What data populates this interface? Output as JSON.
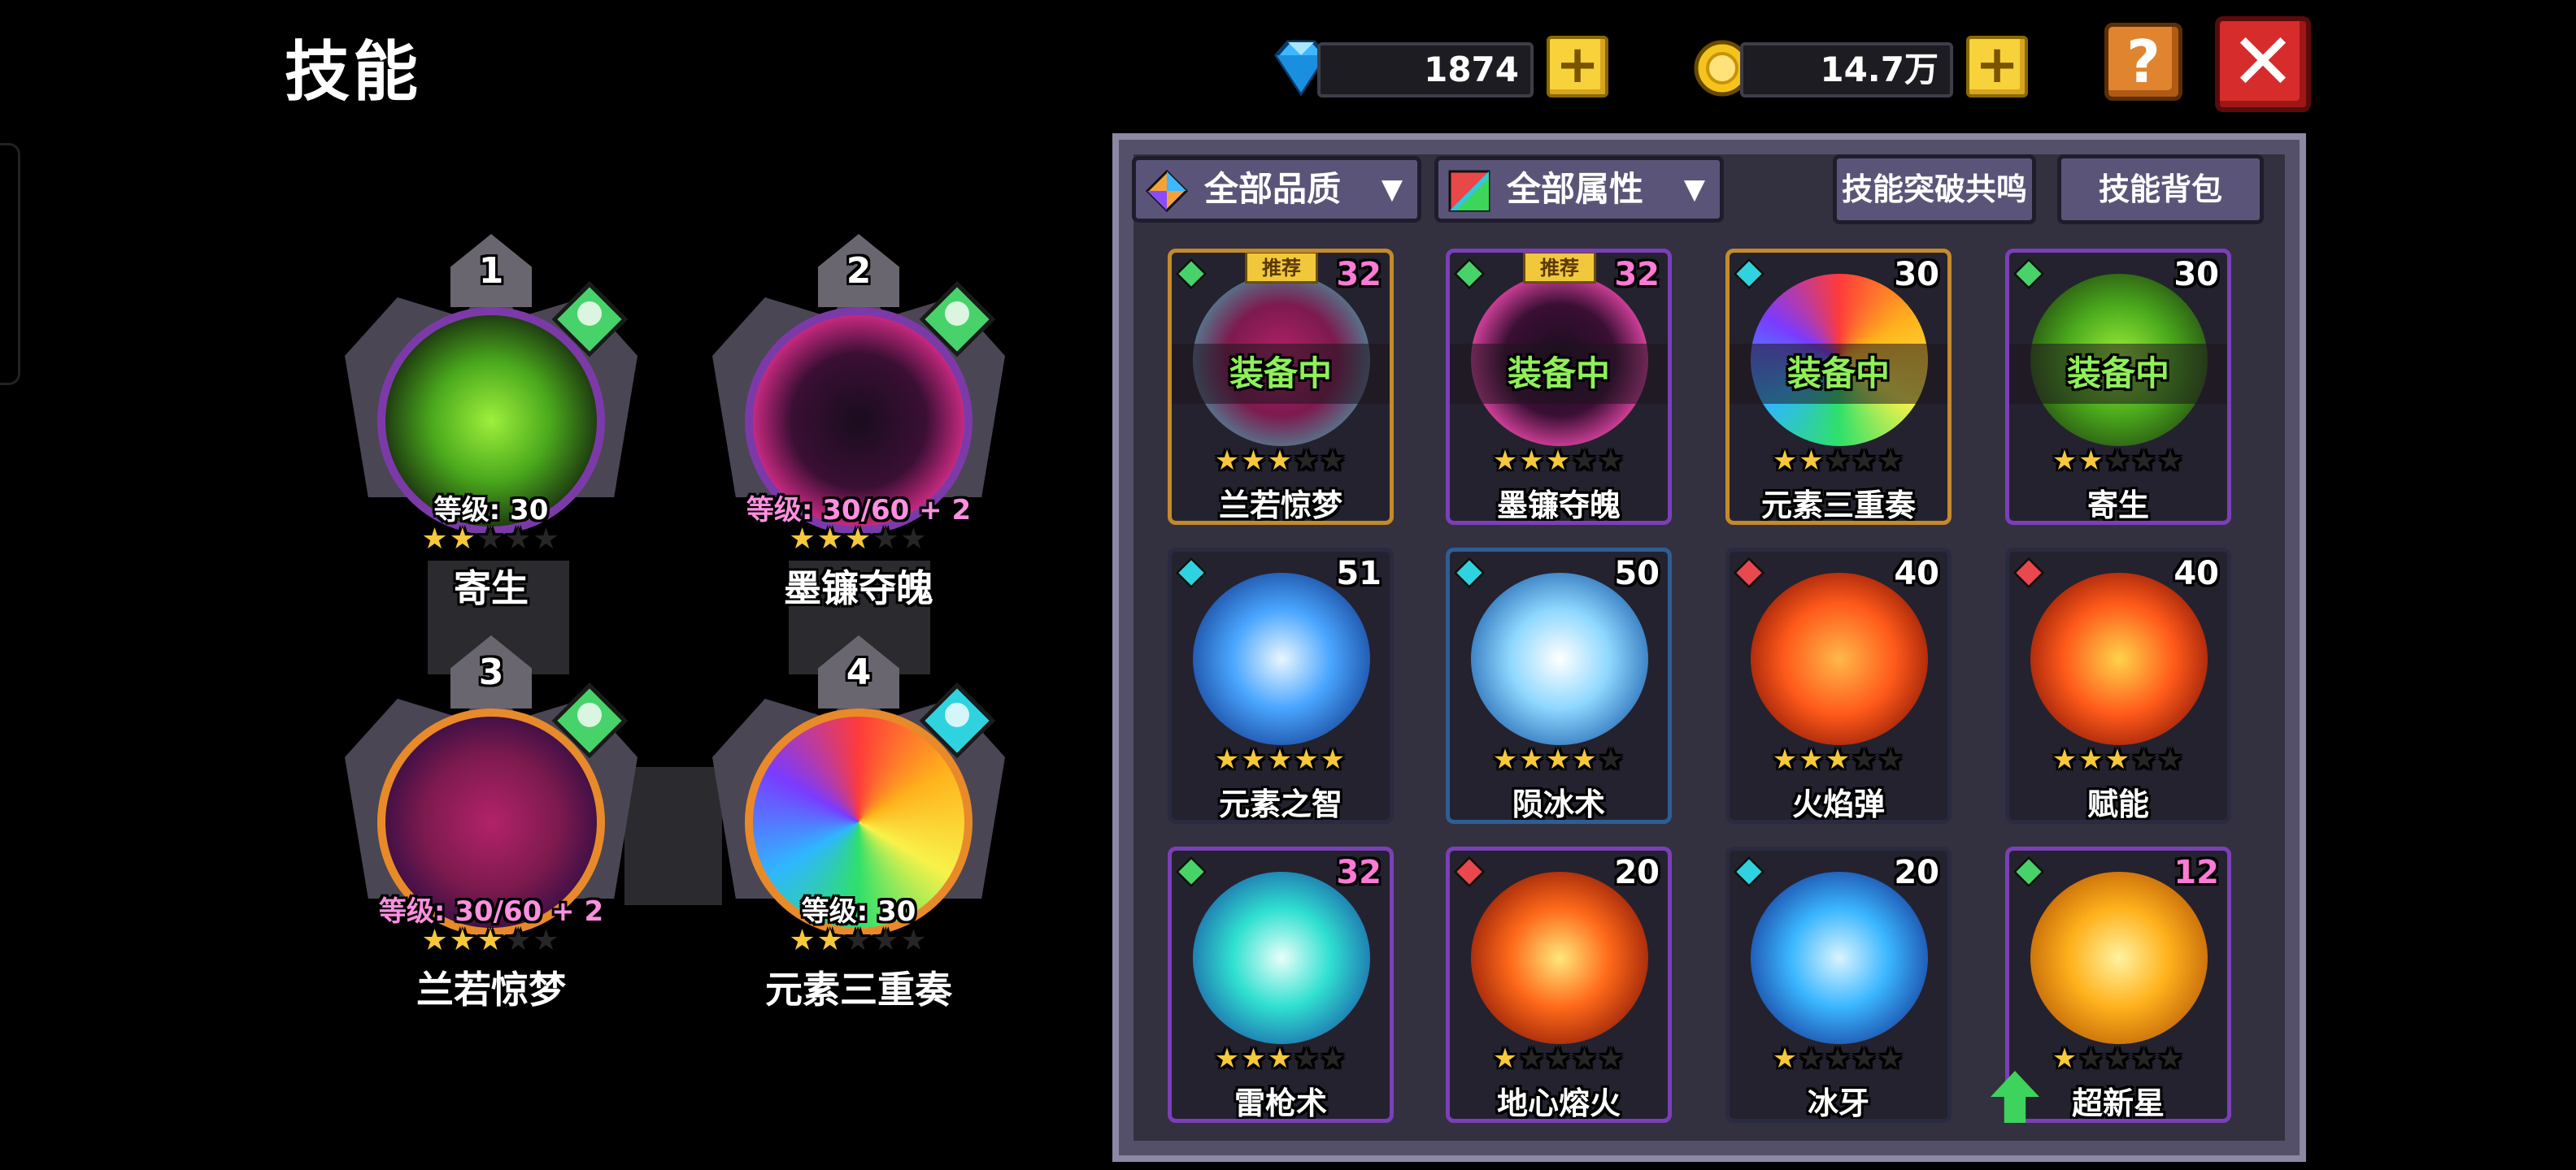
{
  "header": {
    "title": "技能"
  },
  "currencies": {
    "diamond": {
      "value": "1874",
      "icon": "diamond-icon"
    },
    "gold": {
      "value": "14.7万",
      "icon": "gold-coin-icon"
    }
  },
  "buttons": {
    "help": "?",
    "close": "✕",
    "add": "+"
  },
  "equipped_slots": [
    {
      "slot": "1",
      "level": "等级: 30",
      "stars": 2,
      "name": "寄生",
      "gem": "green"
    },
    {
      "slot": "2",
      "level": "等级: 30/60 + 2",
      "stars": 3,
      "name": "墨镰夺魄",
      "gem": "green"
    },
    {
      "slot": "3",
      "level": "等级: 30/60 + 2",
      "stars": 3,
      "name": "兰若惊梦",
      "gem": "green"
    },
    {
      "slot": "4",
      "level": "等级: 30",
      "stars": 2,
      "name": "元素三重奏",
      "gem": "cyan"
    }
  ],
  "filters": {
    "quality": "全部品质",
    "attribute": "全部属性",
    "breakthrough": "技能突破共鸣",
    "bag": "技能背包"
  },
  "labels": {
    "equipped": "装备中",
    "recommended": "推荐"
  },
  "skills": [
    {
      "name": "兰若惊梦",
      "count": "32",
      "stars": 3,
      "equipped": true,
      "recommended": true,
      "gem": "green"
    },
    {
      "name": "墨镰夺魄",
      "count": "32",
      "stars": 3,
      "equipped": true,
      "recommended": true,
      "gem": "green"
    },
    {
      "name": "元素三重奏",
      "count": "30",
      "stars": 2,
      "equipped": true,
      "recommended": false,
      "gem": "cyan"
    },
    {
      "name": "寄生",
      "count": "30",
      "stars": 2,
      "equipped": true,
      "recommended": false,
      "gem": "green"
    },
    {
      "name": "元素之智",
      "count": "51",
      "stars": 5,
      "equipped": false,
      "recommended": false,
      "gem": "cyan"
    },
    {
      "name": "陨冰术",
      "count": "50",
      "stars": 4,
      "equipped": false,
      "recommended": false,
      "gem": "cyan"
    },
    {
      "name": "火焰弹",
      "count": "40",
      "stars": 3,
      "equipped": false,
      "recommended": false,
      "gem": "red"
    },
    {
      "name": "赋能",
      "count": "40",
      "stars": 3,
      "equipped": false,
      "recommended": false,
      "gem": "red"
    },
    {
      "name": "雷枪术",
      "count": "32",
      "stars": 3,
      "equipped": false,
      "recommended": false,
      "gem": "green"
    },
    {
      "name": "地心熔火",
      "count": "20",
      "stars": 1,
      "equipped": false,
      "recommended": false,
      "gem": "red"
    },
    {
      "name": "冰牙",
      "count": "20",
      "stars": 1,
      "equipped": false,
      "recommended": false,
      "gem": "cyan"
    },
    {
      "name": "超新星",
      "count": "12",
      "stars": 1,
      "equipped": false,
      "recommended": false,
      "gem": "green"
    }
  ],
  "colors": {
    "star_on": "#f6c83a",
    "equipped_text": "#8ff05a",
    "count_purple": "#ff7ad6",
    "gem_green": "#47d36a",
    "gem_cyan": "#2fd3e0",
    "gem_red": "#e8484e"
  }
}
